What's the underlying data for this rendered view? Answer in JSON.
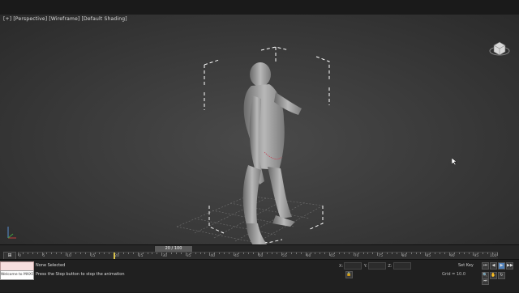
{
  "viewport": {
    "labels": [
      "[+]",
      "[Perspective]",
      "[Wireframe]",
      "[Default Shading]"
    ],
    "background": "#3c3c3c",
    "bracket_color": "#ffffff",
    "grid_color": "#6e6e6e"
  },
  "timeline": {
    "slider_label": "20 / 100",
    "tick_labels": [
      "0",
      "5",
      "10",
      "15",
      "20",
      "25",
      "30",
      "35",
      "40",
      "45",
      "50",
      "55",
      "60",
      "65",
      "70",
      "75",
      "80",
      "85",
      "90",
      "95",
      "100"
    ],
    "key_button": "⊞",
    "current_frame": 20,
    "total_frames": 100
  },
  "status": {
    "objects_selected": "None Selected",
    "prompt": "Press the Stop button to stop the animation",
    "maxscript_output": "Welcome to MAXScript.",
    "coord_x_label": "X:",
    "coord_y_label": "Y:",
    "coord_z_label": "Z:",
    "grid_label": "Grid = 10.0",
    "add_time_tag": "Add Time Tag",
    "frame_info": "Set Key"
  },
  "playback_buttons": [
    "⏮",
    "◀",
    "▶",
    "▶▶",
    "⏭"
  ],
  "icons": {
    "viewcube": "viewcube-icon",
    "cursor": "cursor-icon",
    "axis": "axis-tripod-icon"
  }
}
